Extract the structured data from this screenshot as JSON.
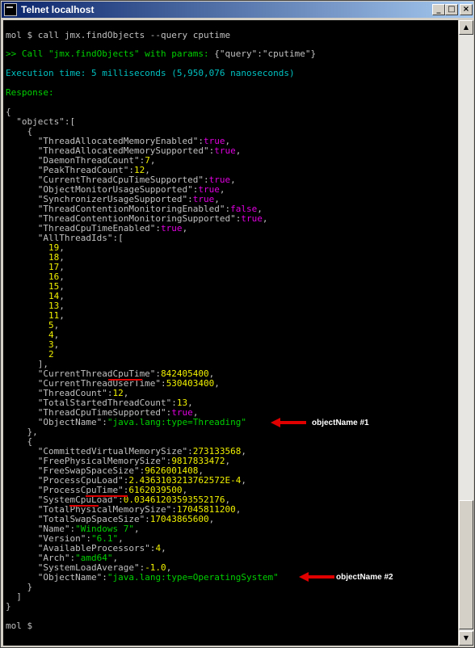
{
  "window": {
    "title": "Telnet localhost"
  },
  "titlebar_buttons": {
    "minimize": "_",
    "maximize": "□",
    "close": "×"
  },
  "terminal": {
    "command_line": "mol $ call jmx.findObjects --query cputime",
    "call_prefix": ">> Call \"jmx.findObjects\" with params: ",
    "call_params": "{\"query\":\"cputime\"}",
    "execution_time": "Execution time: 5 milliseconds (5,950,076 nanoseconds)",
    "response_label": "Response:",
    "open_brace": "{",
    "objects_key": "  \"objects\":[",
    "obj1": {
      "open": "    {",
      "props": [
        {
          "key": "      \"ThreadAllocatedMemoryEnabled\":",
          "value": "true",
          "cls": "m",
          "sep": ","
        },
        {
          "key": "      \"ThreadAllocatedMemorySupported\":",
          "value": "true",
          "cls": "m",
          "sep": ","
        },
        {
          "key": "      \"DaemonThreadCount\":",
          "value": "7",
          "cls": "y",
          "sep": ","
        },
        {
          "key": "      \"PeakThreadCount\":",
          "value": "12",
          "cls": "y",
          "sep": ","
        },
        {
          "key": "      \"CurrentThreadCpuTimeSupported\":",
          "value": "true",
          "cls": "m",
          "sep": ","
        },
        {
          "key": "      \"ObjectMonitorUsageSupported\":",
          "value": "true",
          "cls": "m",
          "sep": ","
        },
        {
          "key": "      \"SynchronizerUsageSupported\":",
          "value": "true",
          "cls": "m",
          "sep": ","
        },
        {
          "key": "      \"ThreadContentionMonitoringEnabled\":",
          "value": "false",
          "cls": "m",
          "sep": ","
        },
        {
          "key": "      \"ThreadContentionMonitoringSupported\":",
          "value": "true",
          "cls": "m",
          "sep": ","
        },
        {
          "key": "      \"ThreadCpuTimeEnabled\":",
          "value": "true",
          "cls": "m",
          "sep": ","
        },
        {
          "key": "      \"AllThreadIds\":[",
          "value": "",
          "cls": "y",
          "sep": ""
        }
      ],
      "thread_ids": [
        "19",
        "18",
        "17",
        "16",
        "15",
        "14",
        "13",
        "11",
        "5",
        "4",
        "3",
        "2"
      ],
      "ids_close": "      ],",
      "props2": [
        {
          "key": "      \"CurrentThreadCpuTime\":",
          "value": "842405400",
          "cls": "y",
          "sep": ","
        },
        {
          "key": "      \"CurrentThreadUserTime\":",
          "value": "530403400",
          "cls": "y",
          "sep": ","
        },
        {
          "key": "      \"ThreadCount\":",
          "value": "12",
          "cls": "y",
          "sep": ","
        },
        {
          "key": "      \"TotalStartedThreadCount\":",
          "value": "13",
          "cls": "y",
          "sep": ","
        },
        {
          "key": "      \"ThreadCpuTimeSupported\":",
          "value": "true",
          "cls": "m",
          "sep": ","
        },
        {
          "key": "      \"ObjectName\":",
          "value": "\"java.lang:type=Threading\"",
          "cls": "g",
          "sep": ""
        }
      ],
      "close": "    },"
    },
    "obj2": {
      "open": "    {",
      "props": [
        {
          "key": "      \"CommittedVirtualMemorySize\":",
          "value": "273133568",
          "cls": "y",
          "sep": ","
        },
        {
          "key": "      \"FreePhysicalMemorySize\":",
          "value": "9817833472",
          "cls": "y",
          "sep": ","
        },
        {
          "key": "      \"FreeSwapSpaceSize\":",
          "value": "9626001408",
          "cls": "y",
          "sep": ","
        },
        {
          "key": "      \"ProcessCpuLoad\":",
          "value": "2.4363103213762572E-4",
          "cls": "y",
          "sep": ","
        },
        {
          "key": "      \"ProcessCpuTime\":",
          "value": "6162039500",
          "cls": "y",
          "sep": ","
        },
        {
          "key": "      \"SystemCpuLoad\":",
          "value": "0.03461203593552176",
          "cls": "y",
          "sep": ","
        },
        {
          "key": "      \"TotalPhysicalMemorySize\":",
          "value": "17045811200",
          "cls": "y",
          "sep": ","
        },
        {
          "key": "      \"TotalSwapSpaceSize\":",
          "value": "17043865600",
          "cls": "y",
          "sep": ","
        },
        {
          "key": "      \"Name\":",
          "value": "\"Windows 7\"",
          "cls": "g",
          "sep": ","
        },
        {
          "key": "      \"Version\":",
          "value": "\"6.1\"",
          "cls": "g",
          "sep": ","
        },
        {
          "key": "      \"AvailableProcessors\":",
          "value": "4",
          "cls": "y",
          "sep": ","
        },
        {
          "key": "      \"Arch\":",
          "value": "\"amd64\"",
          "cls": "g",
          "sep": ","
        },
        {
          "key": "      \"SystemLoadAverage\":",
          "value": "-1.0",
          "cls": "y",
          "sep": ","
        },
        {
          "key": "      \"ObjectName\":",
          "value": "\"java.lang:type=OperatingSystem\"",
          "cls": "g",
          "sep": ""
        }
      ],
      "close": "    }"
    },
    "array_close": "  ]",
    "close_brace": "}",
    "prompt": "mol $ "
  },
  "annotations": {
    "label1": "objectName #1",
    "label2": "objectName #2",
    "arrow_color": "#e00000"
  },
  "colors": {
    "terminal_bg": "#000000",
    "text": "#c0c0c0",
    "green": "#00d000",
    "cyan": "#00c0c0",
    "yellow": "#f0f000",
    "magenta": "#e000e0"
  }
}
